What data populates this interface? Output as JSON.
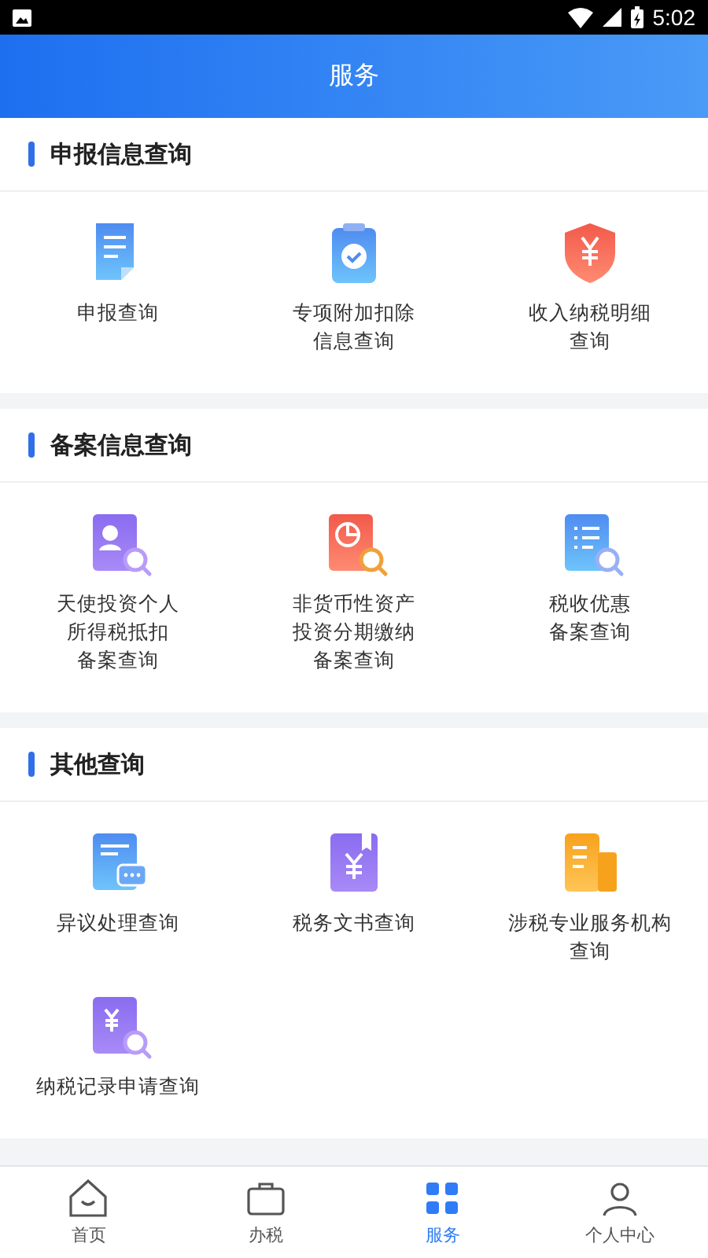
{
  "status_bar": {
    "time": "5:02"
  },
  "header": {
    "title": "服务"
  },
  "sections": [
    {
      "title": "申报信息查询",
      "items": [
        {
          "lines": [
            "申报查询"
          ]
        },
        {
          "lines": [
            "专项附加扣除",
            "信息查询"
          ]
        },
        {
          "lines": [
            "收入纳税明细",
            "查询"
          ]
        }
      ]
    },
    {
      "title": "备案信息查询",
      "items": [
        {
          "lines": [
            "天使投资个人",
            "所得税抵扣",
            "备案查询"
          ]
        },
        {
          "lines": [
            "非货币性资产",
            "投资分期缴纳",
            "备案查询"
          ]
        },
        {
          "lines": [
            "税收优惠",
            "备案查询"
          ]
        }
      ]
    },
    {
      "title": "其他查询",
      "items": [
        {
          "lines": [
            "异议处理查询"
          ]
        },
        {
          "lines": [
            "税务文书查询"
          ]
        },
        {
          "lines": [
            "涉税专业服务机构",
            "查询"
          ]
        },
        {
          "lines": [
            "纳税记录申请查询"
          ]
        }
      ]
    }
  ],
  "tab_bar": [
    {
      "label": "首页",
      "selected": false
    },
    {
      "label": "办税",
      "selected": false
    },
    {
      "label": "服务",
      "selected": true
    },
    {
      "label": "个人中心",
      "selected": false
    }
  ]
}
